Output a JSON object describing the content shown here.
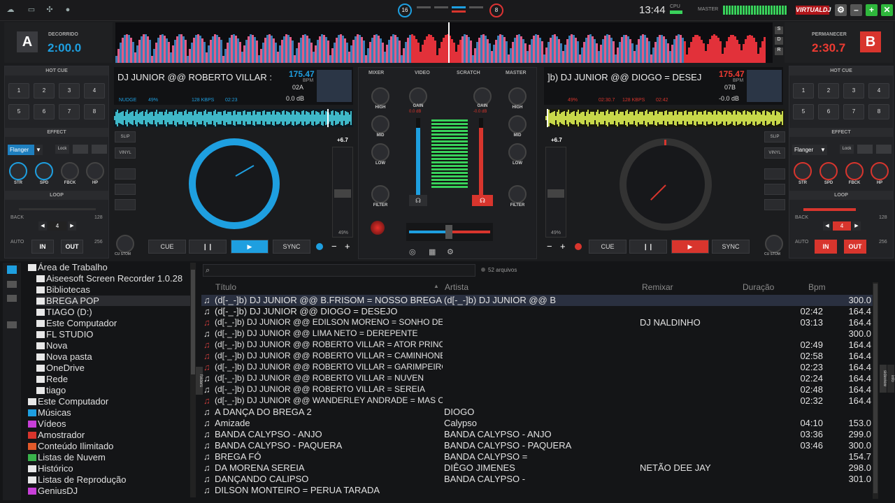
{
  "topbar": {
    "clock": "13:44",
    "cpu_label": "CPU",
    "master_label": "MASTER",
    "brand": "VIRTUALDJ",
    "circle_left": "16",
    "circle_right": "8"
  },
  "deckA": {
    "letter": "A",
    "elapsed_label": "DECORRIDO",
    "time": "2:00.0",
    "title": "DJ JUNIOR @@ ROBERTO VILLAR :",
    "bpm": "175.47",
    "bpm_unit": "BPM",
    "key": "02A",
    "gain": "0.0 dB",
    "nudge": "NUDGE",
    "pct": "49%",
    "kbps": "128 KBPS",
    "pos": "02:23",
    "pitch": "+6.7",
    "pitch_pct": "49%",
    "hotcue_label": "HOT CUE",
    "effect_label": "EFFECT",
    "effect_name": "Flanger",
    "lock_label": "Lock",
    "loop_label": "LOOP",
    "loop_value": "4",
    "back_label": "BACK",
    "auto_label": "AUTO",
    "loop_128": "128",
    "loop_256": "256",
    "in_label": "IN",
    "out_label": "OUT",
    "knobs": [
      "STR",
      "SPD",
      "FBCK",
      "HP"
    ],
    "custom": "CU STOM",
    "cue": "CUE",
    "sync": "SYNC",
    "slip": "SLIP",
    "vinyl": "VINYL"
  },
  "deckB": {
    "letter": "B",
    "remain_label": "PERMANECER",
    "time": "2:30.7",
    "title": "]b) DJ JUNIOR @@ DIOGO = DESEJ",
    "bpm": "175.47",
    "bpm_unit": "BPM",
    "key": "07B",
    "gain": "-0.0 dB",
    "pct": "49%",
    "pos1": "02:30.7",
    "kbps": "128 KBPS",
    "pos": "02:42",
    "pitch": "+6.7",
    "pitch_pct": "49%",
    "hotcue_label": "HOT CUE",
    "effect_label": "EFFECT",
    "effect_name": "Flanger",
    "lock_label": "Lock",
    "loop_label": "LOOP",
    "loop_value": "4",
    "back_label": "BACK",
    "auto_label": "AUTO",
    "loop_128": "128",
    "loop_256": "256",
    "in_label": "IN",
    "out_label": "OUT",
    "knobs": [
      "STR",
      "SPD",
      "FBCK",
      "HP"
    ],
    "custom": "CU STOM",
    "cue": "CUE",
    "sync": "SYNC",
    "slip": "SLIP",
    "vinyl": "VINYL"
  },
  "hotcues": [
    "1",
    "2",
    "3",
    "4",
    "5",
    "6",
    "7",
    "8"
  ],
  "mixer": {
    "tabs": [
      "MIXER",
      "VIDEO",
      "SCRATCH",
      "MASTER"
    ],
    "high": "HIGH",
    "mid": "MID",
    "low": "LOW",
    "filter": "FILTER",
    "gain": "GAIN",
    "gain_a": "0.0 dB",
    "gain_b": "-0.0 dB"
  },
  "browser": {
    "search_placeholder": "",
    "file_count": "52 arquivos",
    "folders_tab": "folders",
    "sideview_tab": "sideview",
    "info_tab": "info",
    "tree": [
      "Área de Trabalho",
      "Aiseesoft Screen Recorder 1.0.28",
      "Bibliotecas",
      "BREGA POP",
      "TIAGO (D:)",
      "Este Computador",
      "FL STUDIO",
      "Nova",
      "Nova pasta",
      "OneDrive",
      "Rede",
      "tiago",
      "Este Computador",
      "Músicas",
      "Vídeos",
      "Amostrador",
      "Conteúdo Ilimitado",
      "Listas de Nuvem",
      "Histórico",
      "Listas de Reprodução",
      "GeniusDJ"
    ],
    "columns": [
      "Título",
      "Artista",
      "Remixar",
      "Duração",
      "Bpm"
    ],
    "rows": [
      {
        "t": "(d[-_-]b) DJ JUNIOR @@ B.FRISOM = NOSSO BREGA",
        "a": "(d[-_-]b) DJ JUNIOR @@ B",
        "r": "",
        "d": "",
        "b": "300.0"
      },
      {
        "t": "(d[-_-]b) DJ JUNIOR @@ DIOGO = DESEJO",
        "a": "",
        "r": "",
        "d": "02:42",
        "b": "164.4"
      },
      {
        "t": "(d[-_-]b) DJ JUNIOR @@ EDILSON MORENO = SONHO DE A",
        "a": "",
        "r": "DJ NALDINHO",
        "d": "03:13",
        "b": "164.4"
      },
      {
        "t": "(d[-_-]b) DJ JUNIOR @@ LIMA NETO = DEREPENTE",
        "a": "",
        "r": "",
        "d": "",
        "b": "300.0"
      },
      {
        "t": "(d[-_-]b) DJ JUNIOR @@ ROBERTO VILLAR = ATOR PRINC",
        "a": "",
        "r": "",
        "d": "02:49",
        "b": "164.4"
      },
      {
        "t": "(d[-_-]b) DJ JUNIOR @@ ROBERTO VILLAR = CAMINHONEI",
        "a": "",
        "r": "",
        "d": "02:58",
        "b": "164.4"
      },
      {
        "t": "(d[-_-]b) DJ JUNIOR @@ ROBERTO VILLAR = GARIMPEIRO",
        "a": "",
        "r": "",
        "d": "02:23",
        "b": "164.4"
      },
      {
        "t": "(d[-_-]b) DJ JUNIOR @@ ROBERTO VILLAR = NUVEN",
        "a": "",
        "r": "",
        "d": "02:24",
        "b": "164.4"
      },
      {
        "t": "(d[-_-]b) DJ JUNIOR @@ ROBERTO VILLAR = SEREIA",
        "a": "",
        "r": "",
        "d": "02:48",
        "b": "164.4"
      },
      {
        "t": "(d[-_-]b) DJ JUNIOR @@ WANDERLEY ANDRADE = MAS CRE",
        "a": "",
        "r": "",
        "d": "02:32",
        "b": "164.4"
      },
      {
        "t": "A DANÇA DO BREGA 2",
        "a": "DIOGO",
        "r": "",
        "d": "",
        "b": ""
      },
      {
        "t": "Amizade",
        "a": "Calypso",
        "r": "",
        "d": "04:10",
        "b": "153.0"
      },
      {
        "t": "BANDA CALYPSO - ANJO",
        "a": "BANDA CALYPSO - ANJO",
        "r": "",
        "d": "03:36",
        "b": "299.0"
      },
      {
        "t": "BANDA CALYPSO - PAQUERA",
        "a": "BANDA CALYPSO - PAQUERA",
        "r": "",
        "d": "03:46",
        "b": "300.0"
      },
      {
        "t": "BREGA FÓ",
        "a": "BANDA CALYPSO =",
        "r": "",
        "d": "",
        "b": "154.7"
      },
      {
        "t": "DA MORENA SEREIA",
        "a": "DIÊGO JIMENES",
        "r": "NETÃO DEE JAY",
        "d": "",
        "b": "298.0"
      },
      {
        "t": "DANÇANDO CALIPSO",
        "a": "BANDA CALYPSO -",
        "r": "",
        "d": "",
        "b": "301.0"
      },
      {
        "t": "DILSON MONTEIRO =  PERUA TARADA",
        "a": "",
        "r": "",
        "d": "",
        "b": ""
      }
    ]
  },
  "colors": {
    "blue": "#1e9fe0",
    "red": "#d8352d",
    "green": "#39d15b"
  }
}
